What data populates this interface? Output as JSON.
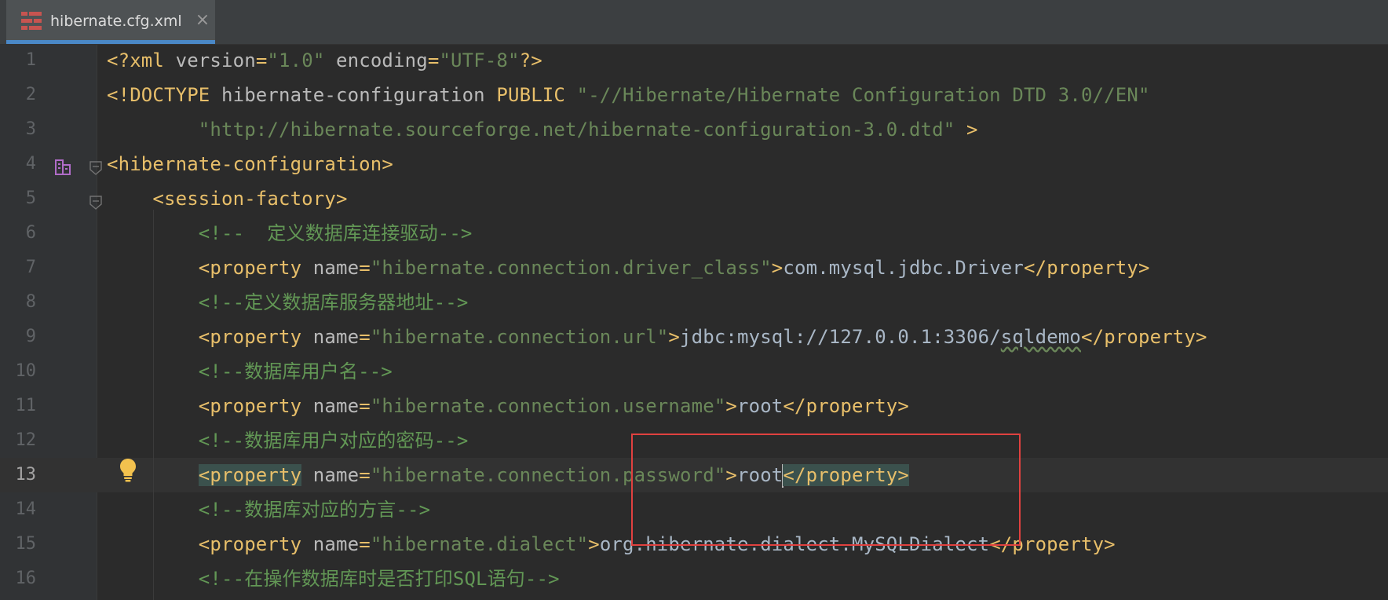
{
  "tab": {
    "title": "hibernate.cfg.xml",
    "close_glyph": "×",
    "icon": "xml-file-icon",
    "underline_color": "#4a88c7"
  },
  "lines": [
    {
      "num": "1",
      "segments": [
        [
          "t",
          "<?xml "
        ],
        [
          "a",
          "version"
        ],
        [
          "t",
          "="
        ],
        [
          "v",
          "\"1.0\""
        ],
        [
          "a",
          " encoding"
        ],
        [
          "t",
          "="
        ],
        [
          "v",
          "\"UTF-8\""
        ],
        [
          "t",
          "?>"
        ]
      ]
    },
    {
      "num": "2",
      "segments": [
        [
          "t",
          "<!DOCTYPE "
        ],
        [
          "a",
          "hibernate-configuration "
        ],
        [
          "t",
          "PUBLIC "
        ],
        [
          "s",
          "\"-//Hibernate/Hibernate Configuration DTD 3.0//EN\""
        ]
      ]
    },
    {
      "num": "3",
      "segments": [
        [
          "s",
          "        \"http://hibernate.sourceforge.net/hibernate-configuration-3.0.dtd\""
        ],
        [
          "t",
          " >"
        ]
      ]
    },
    {
      "num": "4",
      "segments": [
        [
          "t",
          "<hibernate-configuration>"
        ]
      ]
    },
    {
      "num": "5",
      "segments": [
        [
          "t",
          "    <session-factory>"
        ]
      ]
    },
    {
      "num": "6",
      "segments": [
        [
          "c",
          "        <!--  定义数据库连接驱动-->"
        ]
      ]
    },
    {
      "num": "7",
      "segments": [
        [
          "t",
          "        <property "
        ],
        [
          "a",
          "name"
        ],
        [
          "t",
          "="
        ],
        [
          "v",
          "\"hibernate.connection.driver_class\""
        ],
        [
          "t",
          ">"
        ],
        [
          "tx",
          "com.mysql.jdbc.Driver"
        ],
        [
          "t",
          "</property>"
        ]
      ]
    },
    {
      "num": "8",
      "segments": [
        [
          "c",
          "        <!--定义数据库服务器地址-->"
        ]
      ]
    },
    {
      "num": "9",
      "segments": [
        [
          "t",
          "        <property "
        ],
        [
          "a",
          "name"
        ],
        [
          "t",
          "="
        ],
        [
          "v",
          "\"hibernate.connection.url\""
        ],
        [
          "t",
          ">"
        ],
        [
          "tx",
          "jdbc:mysql://127.0.0.1:3306/"
        ],
        [
          "ul",
          "sqldemo"
        ],
        [
          "t",
          "</property>"
        ]
      ]
    },
    {
      "num": "10",
      "segments": [
        [
          "c",
          "        <!--数据库用户名-->"
        ]
      ]
    },
    {
      "num": "11",
      "segments": [
        [
          "t",
          "        <property "
        ],
        [
          "a",
          "name"
        ],
        [
          "t",
          "="
        ],
        [
          "v",
          "\"hibernate.connection.username\""
        ],
        [
          "t",
          ">"
        ],
        [
          "tx",
          "root"
        ],
        [
          "t",
          "</property>"
        ]
      ]
    },
    {
      "num": "12",
      "segments": [
        [
          "c",
          "        <!--数据库用户对应的密码-->"
        ]
      ]
    },
    {
      "num": "13",
      "segments": [
        [
          "tx",
          "        "
        ],
        [
          "thl",
          "<property"
        ],
        [
          "a",
          " name"
        ],
        [
          "t",
          "="
        ],
        [
          "v",
          "\"hibernate.connection.password\""
        ],
        [
          "t",
          ">"
        ],
        [
          "tx",
          "root"
        ],
        [
          "caret",
          ""
        ],
        [
          "thl",
          "</property>"
        ]
      ]
    },
    {
      "num": "14",
      "segments": [
        [
          "c",
          "        <!--数据库对应的方言-->"
        ]
      ]
    },
    {
      "num": "15",
      "segments": [
        [
          "t",
          "        <property "
        ],
        [
          "a",
          "name"
        ],
        [
          "t",
          "="
        ],
        [
          "v",
          "\"hibernate.dialect\""
        ],
        [
          "t",
          ">"
        ],
        [
          "tx",
          "org.hibernate.dialect.MySQLDialect"
        ],
        [
          "t",
          "</property>"
        ]
      ]
    },
    {
      "num": "16",
      "segments": [
        [
          "c",
          "        <!--在操作数据库时是否打印SQL语句-->"
        ]
      ]
    }
  ],
  "current_line": "13",
  "icons": {
    "structure": "structure-icon",
    "intention": "lightbulb-icon",
    "fold": "fold-icon"
  },
  "colors": {
    "highlight_box": "#e0413f",
    "tag": "#e8bf6a",
    "attr_value": "#6a8759",
    "comment": "#629755"
  }
}
